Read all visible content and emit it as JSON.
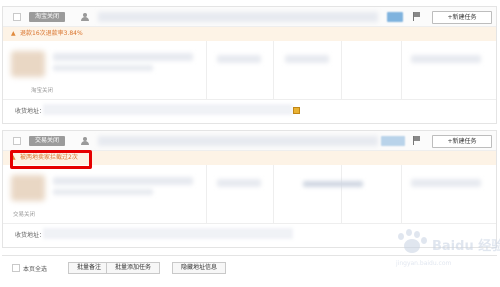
{
  "orders": [
    {
      "status_label": "淘宝关闭",
      "new_task_label": "+新建任务",
      "note_text": "退款16次退款率3.84%",
      "sub_label": "淘宝关闭",
      "address_label": "收货地址："
    },
    {
      "status_label": "交易关闭",
      "new_task_label": "+新建任务",
      "note_text": "被两地卖家拦截过2次",
      "sub_label": "交易关闭",
      "address_label": "收货地址："
    }
  ],
  "footer": {
    "select_all_label": "本页全选",
    "batch_remark_label": "批量备注",
    "batch_add_task_label": "批量添加任务",
    "hide_address_label": "隐藏地址信息"
  },
  "watermark": {
    "text": "Baidu 经验",
    "url": "jingyan.baidu.com"
  },
  "colors": {
    "highlight_border": "#e60000",
    "note_background": "#fdf3e6",
    "note_text": "#d9722a",
    "status_badge": "#9b9b9b"
  }
}
